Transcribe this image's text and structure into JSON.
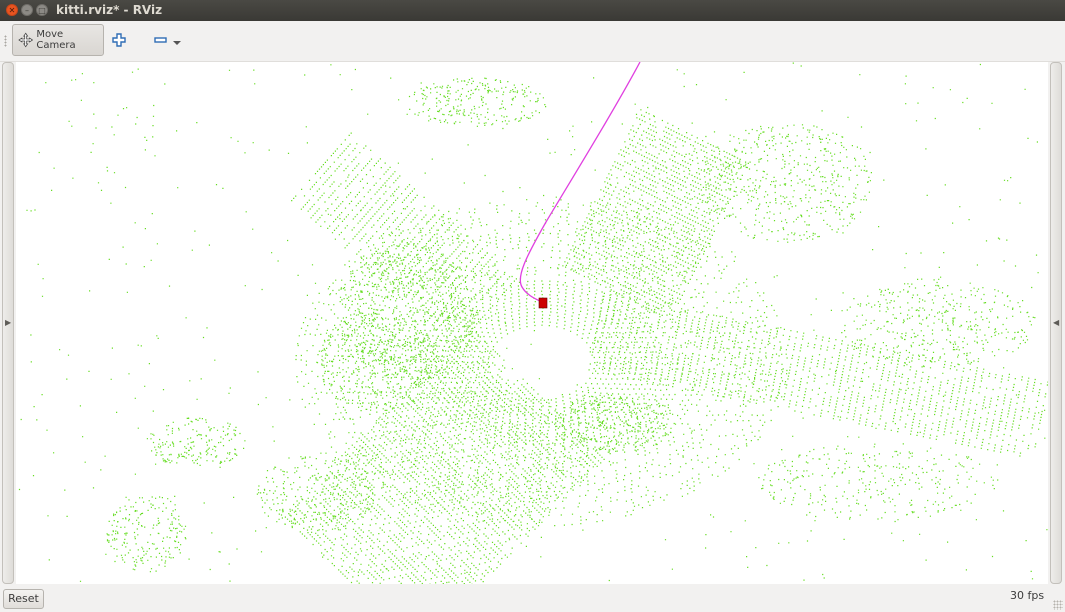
{
  "window": {
    "title": "kitti.rviz* - RViz"
  },
  "toolbar": {
    "move_camera_label": "Move Camera",
    "move_camera_icon": "move-camera-icon",
    "add_icon": "plus-icon",
    "remove_icon": "minus-icon",
    "dropdown_icon": "chevron-down-icon"
  },
  "viewport": {
    "background": "#ffffff",
    "point_color": "#66dd22",
    "path_color": "#e040e0",
    "vehicle_color": "#cc0000"
  },
  "statusbar": {
    "reset_label": "Reset",
    "fps": "30 fps"
  }
}
